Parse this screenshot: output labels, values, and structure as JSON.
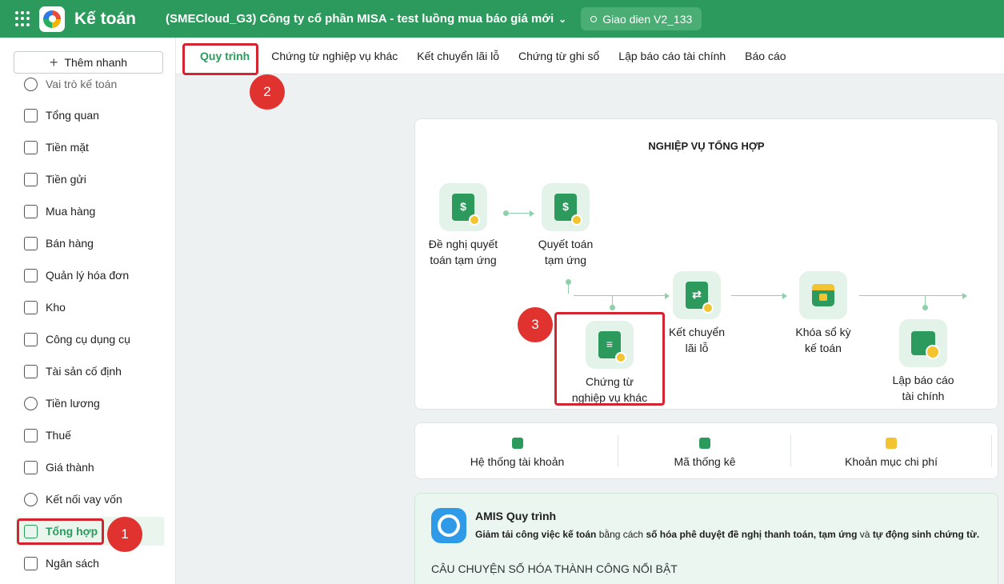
{
  "topbar": {
    "app_title": "Kế toán",
    "company": "(SMECloud_G3) Công ty cổ phần MISA - test luồng mua báo giá mới",
    "ui_version": "Giao dien V2_133"
  },
  "sidebar": {
    "quick_add": "Thêm nhanh",
    "partial_item": "Vai trò kế toán",
    "items": [
      {
        "label": "Tổng quan",
        "icon": "dashboard-icon"
      },
      {
        "label": "Tiền mặt",
        "icon": "cash-icon"
      },
      {
        "label": "Tiền gửi",
        "icon": "bank-icon"
      },
      {
        "label": "Mua hàng",
        "icon": "shopping-bag-icon"
      },
      {
        "label": "Bán hàng",
        "icon": "cart-icon"
      },
      {
        "label": "Quản lý hóa đơn",
        "icon": "invoice-icon"
      },
      {
        "label": "Kho",
        "icon": "warehouse-icon"
      },
      {
        "label": "Công cụ dụng cụ",
        "icon": "tools-icon"
      },
      {
        "label": "Tài sản cố định",
        "icon": "truck-icon"
      },
      {
        "label": "Tiền lương",
        "icon": "dollar-icon"
      },
      {
        "label": "Thuế",
        "icon": "tax-icon"
      },
      {
        "label": "Giá thành",
        "icon": "tag-icon"
      },
      {
        "label": "Kết nối vay vốn",
        "icon": "loan-icon"
      },
      {
        "label": "Tổng hợp",
        "icon": "ledger-icon",
        "active": true
      },
      {
        "label": "Ngân sách",
        "icon": "budget-icon"
      }
    ]
  },
  "tabs": [
    {
      "label": "Quy trình",
      "active": true
    },
    {
      "label": "Chứng từ nghiệp vụ khác"
    },
    {
      "label": "Kết chuyển lãi lỗ"
    },
    {
      "label": "Chứng từ ghi sổ"
    },
    {
      "label": "Lập báo cáo tài chính"
    },
    {
      "label": "Báo cáo"
    }
  ],
  "process": {
    "title": "NGHIỆP VỤ TỔNG HỢP",
    "nodes": {
      "advance_request": {
        "line1": "Đề nghị quyết",
        "line2": "toán tạm ứng"
      },
      "advance_settlement": {
        "line1": "Quyết toán",
        "line2": "tạm ứng"
      },
      "other_vouchers": {
        "line1": "Chứng từ",
        "line2": "nghiệp vụ khác"
      },
      "profit_loss_transfer": {
        "line1": "Kết chuyển",
        "line2": "lãi lỗ"
      },
      "lock_books": {
        "line1": "Khóa sổ kỳ",
        "line2": "kế toán"
      },
      "financial_report": {
        "line1": "Lập báo cáo",
        "line2": "tài chính"
      }
    }
  },
  "quick_links": [
    {
      "label": "Hệ thống tài khoản",
      "icon": "account-system-icon"
    },
    {
      "label": "Mã thống kê",
      "icon": "code-icon"
    },
    {
      "label": "Khoản mục chi phí",
      "icon": "expense-icon"
    }
  ],
  "amis": {
    "title": "AMIS Quy trình",
    "desc_bold1": "Giảm tải công việc kế toán",
    "desc_text1": " bằng cách ",
    "desc_bold2": "số hóa phê duyệt đề nghị thanh toán, tạm ứng",
    "desc_text2": " và ",
    "desc_bold3": "tự động sinh chứng từ.",
    "story": "CÂU CHUYỆN SỐ HÓA THÀNH CÔNG NỔI BẬT"
  },
  "annotations": {
    "badge1": "1",
    "badge2": "2",
    "badge3": "3"
  },
  "colors": {
    "brand": "#2c9a5c",
    "highlight": "#d5232f",
    "badge": "#e0322f"
  }
}
